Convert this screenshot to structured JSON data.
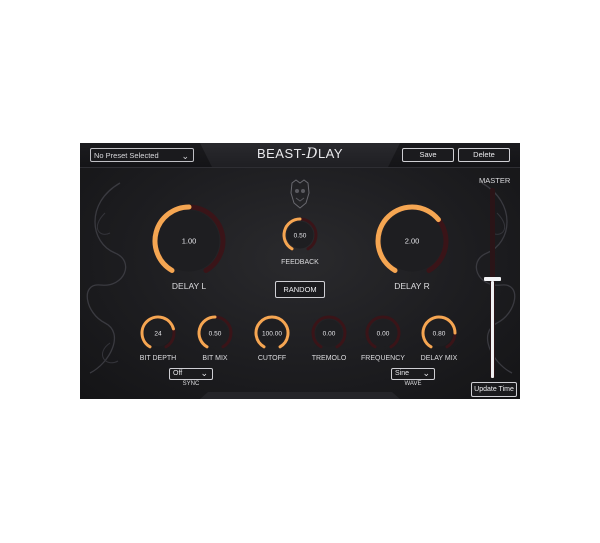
{
  "header": {
    "preset": "No Preset Selected",
    "title_part1": "BEAST-",
    "title_d": "D",
    "title_part2": "LAY",
    "save_label": "Save",
    "delete_label": "Delete"
  },
  "master": {
    "label": "MASTER",
    "level": 0.52
  },
  "big_knobs": [
    {
      "label": "DELAY L",
      "value": "1.00",
      "fill": 0.5
    },
    {
      "label": "DELAY R",
      "value": "2.00",
      "fill": 0.67
    }
  ],
  "feedback": {
    "label": "FEEDBACK",
    "value": "0.50",
    "fill": 0.5
  },
  "random_label": "RANDOM",
  "small_knobs": [
    {
      "label": "BIT DEPTH",
      "value": "24",
      "fill": 0.75
    },
    {
      "label": "BIT MIX",
      "value": "0.50",
      "fill": 0.5
    },
    {
      "label": "CUTOFF",
      "value": "100.00",
      "fill": 1.0
    },
    {
      "label": "TREMOLO",
      "value": "0.00",
      "fill": 0.0
    },
    {
      "label": "FREQUENCY",
      "value": "0.00",
      "fill": 0.0
    },
    {
      "label": "DELAY MIX",
      "value": "0.80",
      "fill": 0.8
    }
  ],
  "sync": {
    "label": "SYNC",
    "value": "Off"
  },
  "wave": {
    "label": "WAVE",
    "value": "Sine"
  },
  "update_time_label": "Update Time",
  "icons": {
    "chevron": "chevron-down-icon",
    "logo": "beast-head-logo-icon"
  },
  "colors": {
    "accent": "#f5a652",
    "track": "#3a1418",
    "background": "#1d1d20"
  }
}
